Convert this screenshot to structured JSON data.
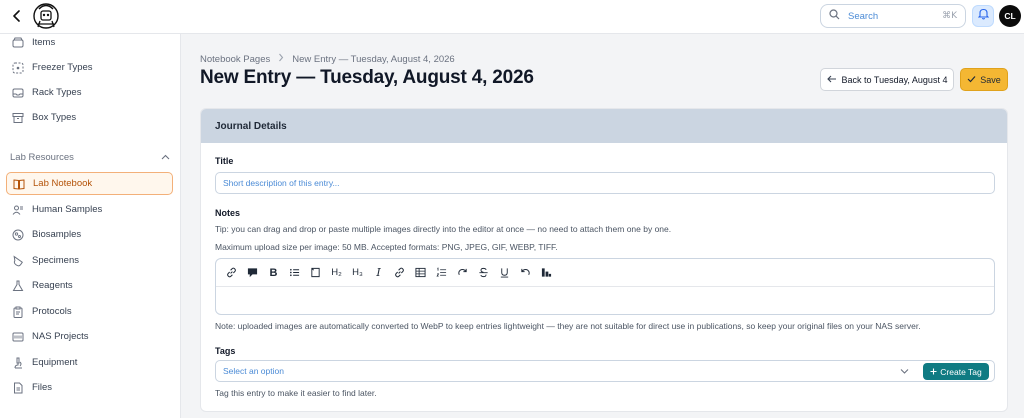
{
  "search": {
    "placeholder": "Search",
    "shortcut": "⌘K"
  },
  "user": {
    "initials": "CL"
  },
  "sidebar": {
    "items_top": [
      {
        "label": "Items",
        "icon": "box-stack-icon"
      },
      {
        "label": "Freezer Types",
        "icon": "snowflake-grid-icon"
      },
      {
        "label": "Rack Types",
        "icon": "tray-icon"
      },
      {
        "label": "Box Types",
        "icon": "archive-box-icon"
      }
    ],
    "section_title": "Lab Resources",
    "items_bottom": [
      {
        "label": "Lab Notebook",
        "icon": "book-open-icon",
        "active": true
      },
      {
        "label": "Human Samples",
        "icon": "users-icon"
      },
      {
        "label": "Biosamples",
        "icon": "dna-icon"
      },
      {
        "label": "Specimens",
        "icon": "test-tube-icon"
      },
      {
        "label": "Reagents",
        "icon": "flask-icon"
      },
      {
        "label": "Protocols",
        "icon": "clipboard-icon"
      },
      {
        "label": "NAS Projects",
        "icon": "server-icon"
      },
      {
        "label": "Equipment",
        "icon": "microscope-icon"
      },
      {
        "label": "Files",
        "icon": "file-icon"
      }
    ]
  },
  "breadcrumb": {
    "parent": "Notebook Pages",
    "current": "New Entry — Tuesday, August 4, 2026"
  },
  "page": {
    "title": "New Entry — Tuesday, August 4, 2026",
    "back_label": "Back to Tuesday, August 4",
    "save_label": "Save"
  },
  "form": {
    "section_title": "Journal Details",
    "title_label": "Title",
    "title_placeholder": "Short description of this entry...",
    "notes_label": "Notes",
    "notes_tip": "Tip: you can drag and drop or paste multiple images directly into the editor at once — no need to attach them one by one.",
    "notes_limits": "Maximum upload size per image: 50 MB. Accepted formats: PNG, JPEG, GIF, WEBP, TIFF.",
    "notes_note": "Note: uploaded images are automatically converted to WebP to keep entries lightweight — they are not suitable for direct use in publications, so keep your original files on your NAS server.",
    "tags_label": "Tags",
    "tags_placeholder": "Select an option",
    "create_tag_label": "Create Tag",
    "tags_hint": "Tag this entry to make it easier to find later."
  },
  "toolbar": {
    "heading2": "H₂",
    "heading3": "H₃",
    "buttons": [
      "link-icon",
      "comment-icon",
      "bold-icon",
      "bullet-list-icon",
      "note-icon",
      "heading2-icon",
      "heading3-icon",
      "italic-icon",
      "link-chain-icon",
      "table-icon",
      "numbered-list-icon",
      "redo-icon",
      "strikethrough-icon",
      "underline-icon",
      "undo-icon",
      "chart-icon"
    ]
  },
  "colors": {
    "accent": "#f4b733",
    "teal": "#0f7b83",
    "header": "#cbd5e1",
    "active_border": "#f3b079"
  }
}
